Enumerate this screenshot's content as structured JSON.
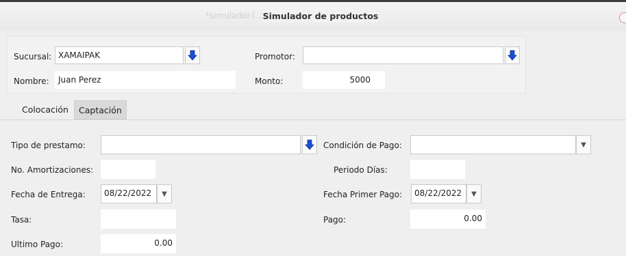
{
  "window": {
    "ghost_title": "*simulador.( … )s) - LaTeXila",
    "title": "Simulador de productos"
  },
  "header": {
    "sucursal_label": "Sucursal:",
    "sucursal_value": "XAMAIPAK",
    "promotor_label": "Promotor:",
    "promotor_value": "",
    "nombre_label": "Nombre:",
    "nombre_value": "Juan Perez",
    "monto_label": "Monto:",
    "monto_value": "5000"
  },
  "tabs": [
    "Colocación",
    "Captación"
  ],
  "form": {
    "tipo_prestamo_label": "Tipo de prestamo:",
    "tipo_prestamo_value": "",
    "condicion_pago_label": "Condición de Pago:",
    "condicion_pago_value": "",
    "amortizaciones_label": "No. Amortizaciones:",
    "amortizaciones_value": "",
    "periodo_dias_label": "Periodo Días:",
    "periodo_dias_value": "",
    "fecha_entrega_label": "Fecha de Entrega:",
    "fecha_entrega_value": "08/22/2022",
    "fecha_primer_pago_label": "Fecha Primer Pago:",
    "fecha_primer_pago_value": "08/22/2022",
    "tasa_label": "Tasa:",
    "tasa_value": "",
    "pago_label": "Pago:",
    "pago_value": "0.00",
    "ultimo_pago_label": "Ultimo Pago:",
    "ultimo_pago_value": "0.00"
  },
  "icons": {
    "lookup": "arrow-down-icon",
    "dropdown": "triangle-down-icon"
  },
  "colors": {
    "arrow_blue": "#1a4fd6",
    "close_ring": "#e38c8c"
  }
}
